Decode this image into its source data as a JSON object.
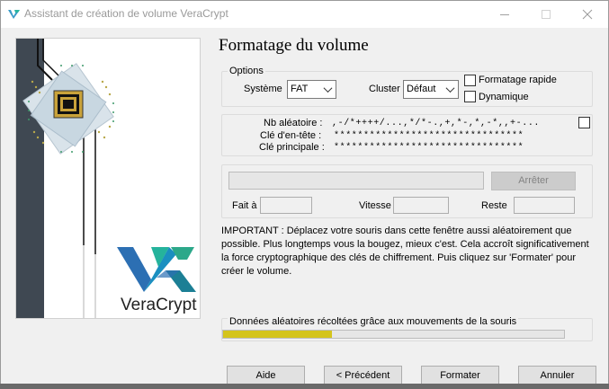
{
  "window": {
    "title": "Assistant de création de volume VeraCrypt"
  },
  "banner": {
    "logo_text": "VeraCrypt"
  },
  "page_heading": "Formatage du volume",
  "options": {
    "group_label": "Options",
    "filesystem_label": "Système",
    "filesystem_value": "FAT",
    "cluster_label": "Cluster",
    "cluster_value": "Défaut",
    "quick_format_label": "Formatage rapide",
    "dynamic_label": "Dynamique"
  },
  "keys": {
    "random_label": "Nb aléatoire :",
    "random_value": ",-/*++++/...,*/*-.,+,*-,*,-*,,+-...",
    "header_key_label": "Clé d'en-tête :",
    "header_key_value": "********************************",
    "master_key_label": "Clé principale :",
    "master_key_value": "********************************"
  },
  "progress": {
    "abort_label": "Arrêter",
    "done_label": "Fait à",
    "speed_label": "Vitesse",
    "remaining_label": "Reste"
  },
  "important_text": "IMPORTANT : Déplacez votre souris dans cette fenêtre aussi aléatoirement que possible. Plus longtemps vous la bougez, mieux c'est. Cela accroît significativement la force cryptographique des clés de chiffrement. Puis cliquez sur 'Formater' pour créer le volume.",
  "randomness": {
    "label": "Données aléatoires récoltées grâce aux mouvements de la souris",
    "fill_fraction": 0.32,
    "color": "#d4c41c"
  },
  "buttons": {
    "help": "Aide",
    "previous": "< Précédent",
    "format": "Formater",
    "cancel": "Annuler"
  }
}
